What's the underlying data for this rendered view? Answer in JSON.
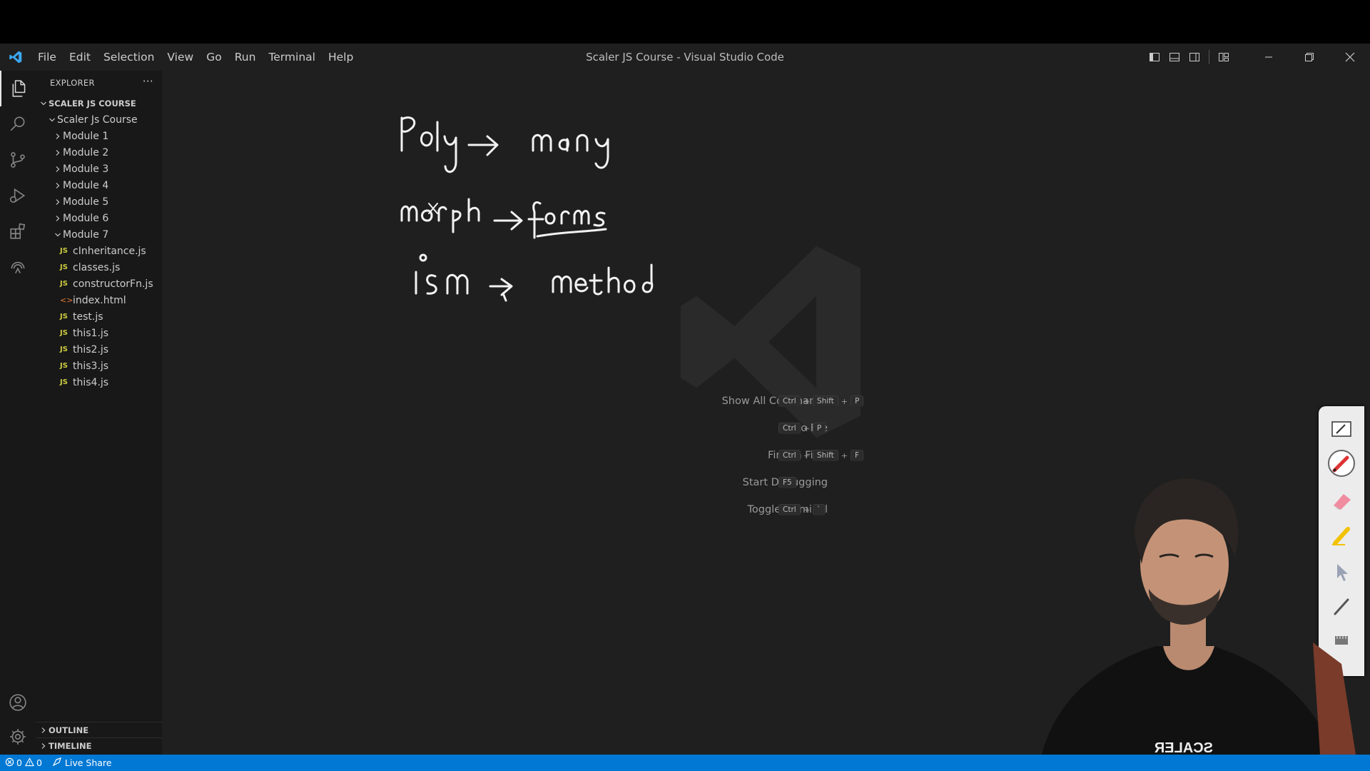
{
  "window": {
    "title": "Scaler JS Course - Visual Studio Code"
  },
  "menu": [
    "File",
    "Edit",
    "Selection",
    "View",
    "Go",
    "Run",
    "Terminal",
    "Help"
  ],
  "sidebar": {
    "header": "EXPLORER",
    "more": "···",
    "root": "SCALER JS COURSE",
    "folder": "Scaler Js Course",
    "modules": [
      "Module 1",
      "Module 2",
      "Module 3",
      "Module 4",
      "Module 5",
      "Module 6"
    ],
    "open_module": "Module 7",
    "files": [
      {
        "name": "cInheritance.js",
        "type": "JS"
      },
      {
        "name": "classes.js",
        "type": "JS"
      },
      {
        "name": "constructorFn.js",
        "type": "JS"
      },
      {
        "name": "index.html",
        "type": "html"
      },
      {
        "name": "test.js",
        "type": "JS"
      },
      {
        "name": "this1.js",
        "type": "JS"
      },
      {
        "name": "this2.js",
        "type": "JS"
      },
      {
        "name": "this3.js",
        "type": "JS"
      },
      {
        "name": "this4.js",
        "type": "JS"
      }
    ],
    "outline": "OUTLINE",
    "timeline": "TIMELINE"
  },
  "shortcuts": [
    {
      "label": "Show All Commands",
      "keys": [
        "Ctrl",
        "Shift",
        "P"
      ]
    },
    {
      "label": "Go to File",
      "keys": [
        "Ctrl",
        "P"
      ]
    },
    {
      "label": "Find in Files",
      "keys": [
        "Ctrl",
        "Shift",
        "F"
      ]
    },
    {
      "label": "Start Debugging",
      "keys": [
        "F5"
      ]
    },
    {
      "label": "Toggle Terminal",
      "keys": [
        "Ctrl",
        "`"
      ]
    }
  ],
  "statusbar": {
    "errors": "0",
    "warnings": "0",
    "live_share": "Live Share"
  },
  "webcam": {
    "shirt_text": "SCALER"
  },
  "colors": {
    "statusbar": "#0078d4",
    "titlebar": "#1f1f1f",
    "editor": "#1f1f1f",
    "sidebar": "#181818",
    "js_badge": "#cbcb41",
    "html_badge": "#e37933"
  },
  "icons": [
    "vscode-logo-icon",
    "explorer-icon",
    "search-icon",
    "source-control-icon",
    "run-debug-icon",
    "extensions-icon",
    "remote-explorer-icon",
    "accounts-icon",
    "settings-gear-icon",
    "toggle-primary-sidebar-icon",
    "toggle-panel-icon",
    "toggle-secondary-sidebar-icon",
    "customize-layout-icon",
    "minimize-icon",
    "restore-icon",
    "close-icon",
    "pen-icon",
    "eraser-icon",
    "highlighter-icon",
    "pointer-icon",
    "ruler-icon"
  ]
}
